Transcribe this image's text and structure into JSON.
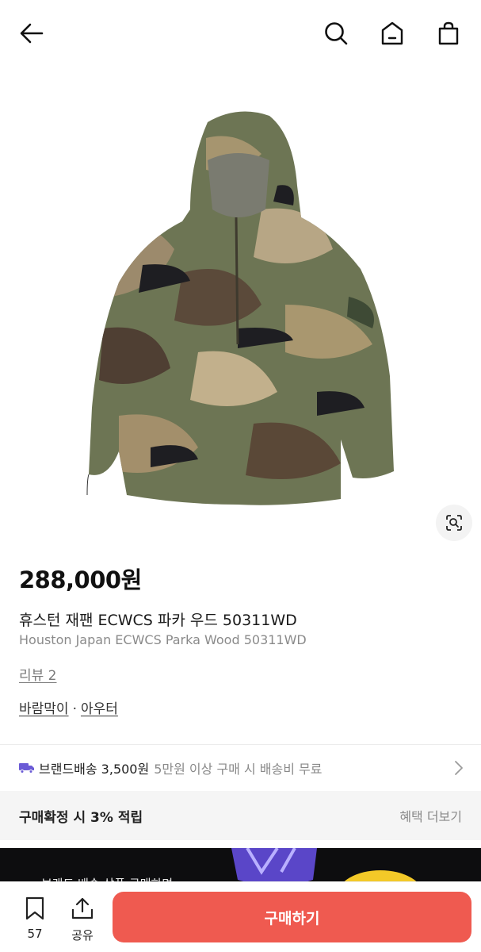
{
  "header": {
    "back_icon": "arrow-left-icon",
    "search_icon": "search-icon",
    "home_icon": "home-icon",
    "cart_icon": "shopping-bag-icon"
  },
  "product": {
    "image_alt": "camouflage hooded parka",
    "lens_icon": "image-search-icon",
    "price": "288,000원",
    "name_ko": "휴스턴 재팬 ECWCS 파카 우드 50311WD",
    "name_en": "Houston Japan ECWCS Parka Wood 50311WD",
    "review": "리뷰 2",
    "category_1": "바람막이",
    "category_sep": "·",
    "category_2": "아우터"
  },
  "shipping": {
    "icon": "truck-icon",
    "label": "브랜드배송 3,500원",
    "condition": "5만원 이상 구매 시 배송비 무료",
    "chevron": "chevron-right-icon"
  },
  "benefit": {
    "label": "구매확정 시 3% 적립",
    "more": "혜택 더보기"
  },
  "banner": {
    "text": "브랜드 배송 상품 구매하면"
  },
  "bottom_bar": {
    "bookmark_count": "57",
    "share_label": "공유",
    "buy_label": "구매하기"
  },
  "colors": {
    "accent": "#ef5a50",
    "ship_icon": "#6b5bd6",
    "muted": "#8a8a8a"
  }
}
